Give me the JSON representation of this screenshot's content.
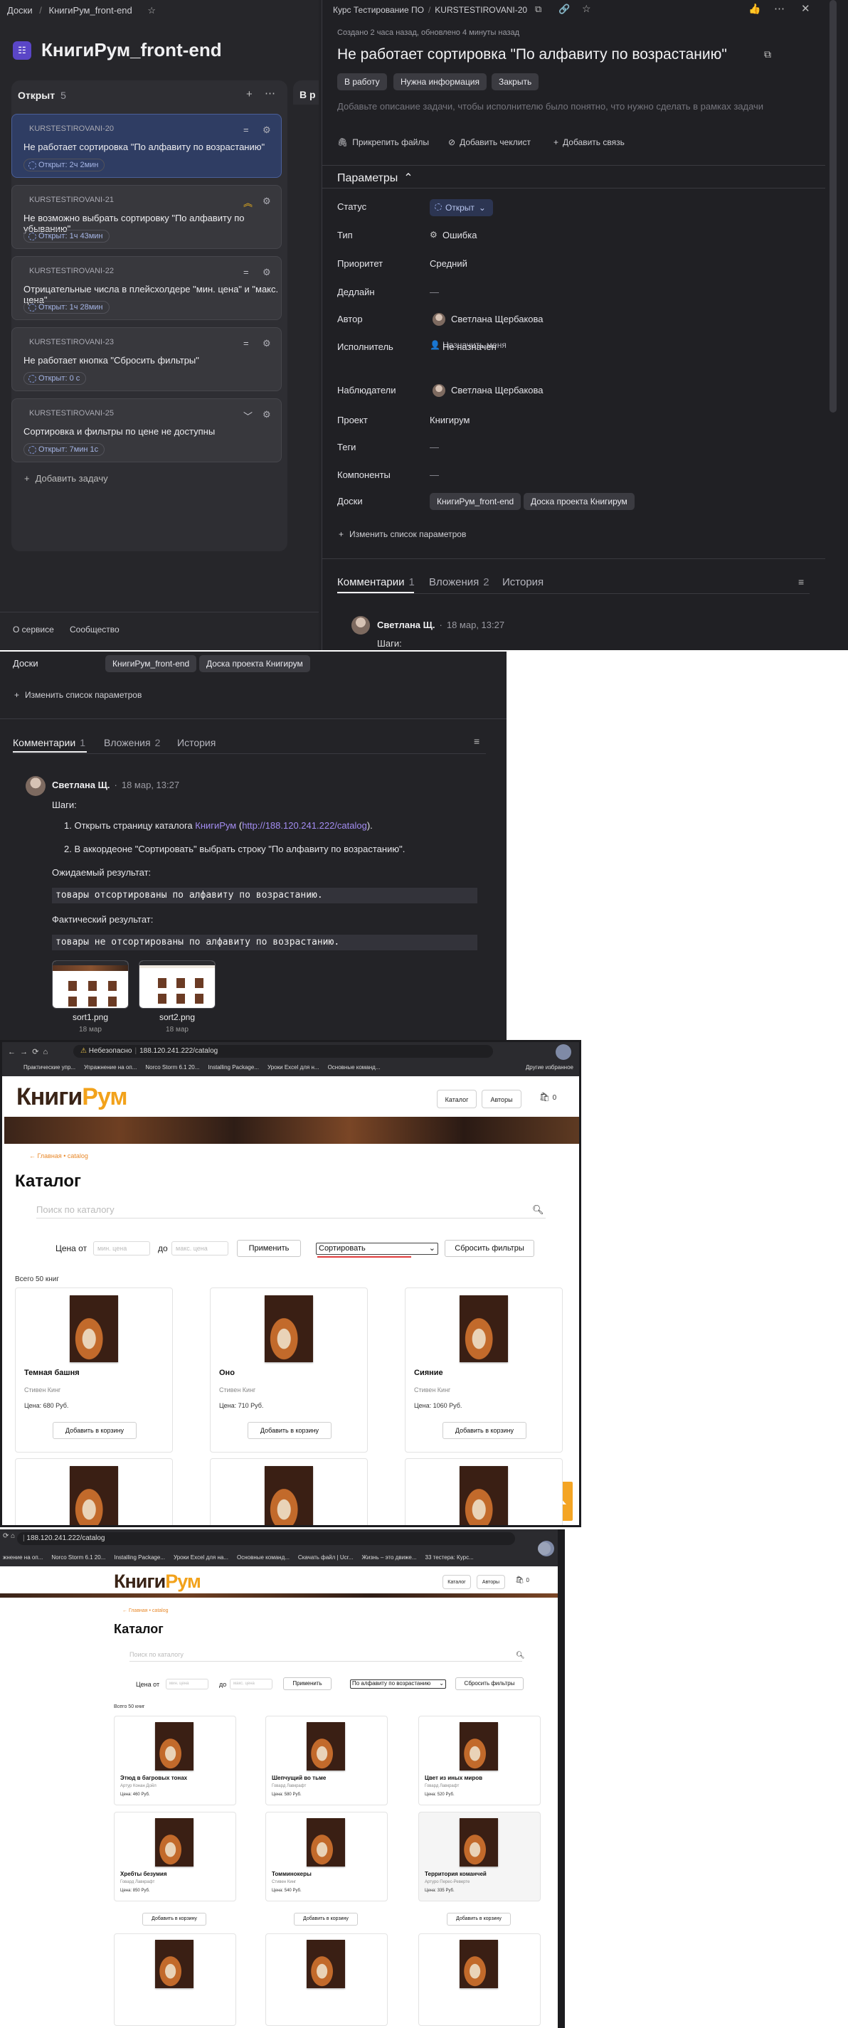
{
  "tracker": {
    "breadcrumb": [
      "Доски",
      "КнигиРум_front-end"
    ],
    "board_title": "КнигиРум_front-end",
    "column": {
      "title": "Открыт",
      "count": "5",
      "next_col_prefix": "В р"
    },
    "cards": [
      {
        "key": "KURSTESTIROVANI-20",
        "title": "Не работает сортировка \"По алфавиту по возрастанию\"",
        "badge": "Открыт: 2ч 2мин",
        "prio": "="
      },
      {
        "key": "KURSTESTIROVANI-21",
        "title": "Не возможно выбрать сортировку \"По алфавиту по убыванию\"",
        "badge": "Открыт: 1ч 43мин",
        "prio": "︽"
      },
      {
        "key": "KURSTESTIROVANI-22",
        "title": "Отрицательные числа в плейсхолдере \"мин. цена\" и \"макс. цена\"",
        "badge": "Открыт: 1ч 28мин",
        "prio": "="
      },
      {
        "key": "KURSTESTIROVANI-23",
        "title": "Не работает кнопка \"Сбросить фильтры\"",
        "badge": "Открыт: 0 с",
        "prio": "="
      },
      {
        "key": "KURSTESTIROVANI-25",
        "title": "Сортировка и фильтры по цене не доступны",
        "badge": "Открыт: 7мин 1с",
        "prio": "﹀"
      }
    ],
    "add_task": "Добавить задачу",
    "footer": [
      "О сервисе",
      "Сообщество"
    ],
    "issue": {
      "breadcrumb": [
        "Курс Тестирование ПО",
        "KURSTESTIROVANI-20"
      ],
      "meta": "Создано 2 часа назад, обновлено 4 минуты назад",
      "title": "Не работает сортировка \"По алфавиту по возрастанию\"",
      "actions": [
        "В работу",
        "Нужна информация",
        "Закрыть"
      ],
      "desc_placeholder": "Добавьте описание задачи, чтобы исполнителю было понятно, что нужно сделать в рамках задачи",
      "attach": [
        "Прикрепить файлы",
        "Добавить чеклист",
        "Добавить связь"
      ],
      "params_title": "Параметры",
      "params": [
        {
          "label": "Статус",
          "value": "Открыт"
        },
        {
          "label": "Тип",
          "value": "Ошибка"
        },
        {
          "label": "Приоритет",
          "value": "Средний"
        },
        {
          "label": "Дедлайн",
          "value": "—"
        },
        {
          "label": "Автор",
          "value": "Светлана Щербакова"
        },
        {
          "label": "Исполнитель",
          "value": "Не назначен"
        },
        {
          "label": "Наблюдатели",
          "value": "Светлана Щербакова"
        },
        {
          "label": "Проект",
          "value": "Книгирум"
        },
        {
          "label": "Теги",
          "value": "—"
        },
        {
          "label": "Компоненты",
          "value": "—"
        },
        {
          "label": "Доски",
          "value": ""
        }
      ],
      "assign_me": "Назначить меня",
      "boards": [
        "КнигиРум_front-end",
        "Доска проекта Книгирум"
      ],
      "change_params": "Изменить список параметров",
      "tabs": [
        {
          "label": "Комментарии",
          "count": "1"
        },
        {
          "label": "Вложения",
          "count": "2"
        },
        {
          "label": "История",
          "count": ""
        }
      ],
      "comment_author": "Светлана Щ.",
      "comment_date": "18 мар, 13:27",
      "comment_first": "Шаги:"
    }
  },
  "comment": {
    "boards_label": "Доски",
    "boards": [
      "КнигиРум_front-end",
      "Доска проекта Книгирум"
    ],
    "change_params": "Изменить список параметров",
    "tabs": [
      {
        "label": "Комментарии",
        "count": "1"
      },
      {
        "label": "Вложения",
        "count": "2"
      },
      {
        "label": "История",
        "count": ""
      }
    ],
    "author": "Светлана Щ.",
    "date": "18 мар, 13:27",
    "steps_label": "Шаги:",
    "step1_prefix": "1. Открыть страницу каталога ",
    "step1_link1": "КнигиРум",
    "step1_link2": "http://188.120.241.222/catalog",
    "step1_suffix": ").",
    "step2": "2. В аккордеоне \"Сортировать\" выбрать строку \"По алфавиту по возрастанию\".",
    "expected_label": "Ожидаемый результат:",
    "expected": "товары отсортированы по алфавиту по возрастанию.",
    "actual_label": "Фактический результат:",
    "actual": "товары не отсортированы по алфавиту по возрастанию.",
    "attachments": [
      {
        "name": "sort1.png",
        "date": "18 мар"
      },
      {
        "name": "sort2.png",
        "date": "18 мар"
      }
    ]
  },
  "site1": {
    "security": "Небезопасно",
    "url": "188.120.241.222/catalog",
    "bookmarks": [
      "Практические упр...",
      "Упражнение на оп...",
      "Norco Storm 6.1 20...",
      "Installing Package...",
      "Уроки Excel для н...",
      "Основные команд..."
    ],
    "bookmarks_other": "Другие избранное",
    "logo_a": "Книги",
    "logo_b": "Рум",
    "nav": [
      "Каталог",
      "Авторы"
    ],
    "cart_count": "0",
    "breadcrumb": "← Главная • catalog",
    "title": "Каталог",
    "search_placeholder": "Поиск по каталогу",
    "price_from": "Цена от",
    "price_to": "до",
    "min_placeholder": "мин. цена",
    "max_placeholder": "макс. цена",
    "apply": "Применить",
    "sort_value": "Сортировать",
    "reset": "Сбросить фильтры",
    "total": "Всего 50 книг",
    "add_to_cart": "Добавить в корзину",
    "books": [
      {
        "title": "Темная башня",
        "author": "Стивен Кинг",
        "price": "Цена: 680 Руб."
      },
      {
        "title": "Оно",
        "author": "Стивен Кинг",
        "price": "Цена: 710 Руб."
      },
      {
        "title": "Сияние",
        "author": "Стивен Кинг",
        "price": "Цена: 1060 Руб."
      }
    ]
  },
  "site2": {
    "url": "188.120.241.222/catalog",
    "bookmarks": [
      "жнение на оп...",
      "Norco Storm 6.1 20...",
      "Installing Package...",
      "Уроки Excel для на...",
      "Основные команд...",
      "Скачать файл | Ucr...",
      "Жизнь – это движе...",
      "33 тестера: Курс..."
    ],
    "logo_a": "Книги",
    "logo_b": "Рум",
    "nav": [
      "Каталог",
      "Авторы"
    ],
    "cart_count": "0",
    "breadcrumb": "← Главная • catalog",
    "title": "Каталог",
    "search_placeholder": "Поиск по каталогу",
    "price_from": "Цена от",
    "price_to": "до",
    "min_placeholder": "мин. цена",
    "max_placeholder": "макс. цена",
    "apply": "Применить",
    "sort_value": "По алфавиту по возрастанию",
    "reset": "Сбросить фильтры",
    "total": "Всего 50 книг",
    "add_to_cart": "Добавить в корзину",
    "books": [
      {
        "title": "Этюд в багровых тонах",
        "author": "Артур Конан Дойл",
        "price": "Цена: 460 Руб."
      },
      {
        "title": "Шепчущий во тьме",
        "author": "Говард Лавкрафт",
        "price": "Цена: 580 Руб."
      },
      {
        "title": "Цвет из иных миров",
        "author": "Говард Лавкрафт",
        "price": "Цена: 520 Руб."
      },
      {
        "title": "Хребты безумия",
        "author": "Говард Лавкрафт",
        "price": "Цена: 850 Руб."
      },
      {
        "title": "Томминокеры",
        "author": "Стивен Кинг",
        "price": "Цена: 540 Руб."
      },
      {
        "title": "Территория команчей",
        "author": "Артуро Перес-Реверте",
        "price": "Цена: 335 Руб."
      }
    ]
  }
}
